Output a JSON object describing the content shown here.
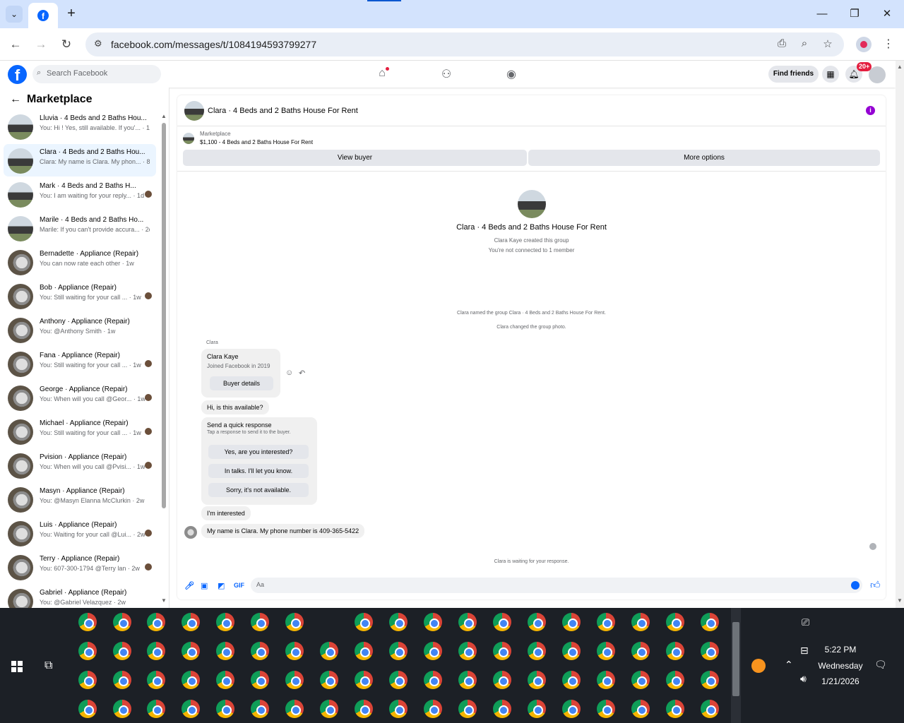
{
  "browser": {
    "url": "facebook.com/messages/t/1084194593799277",
    "new_tab_symbol": "+"
  },
  "facebook": {
    "search_placeholder": "Search Facebook",
    "find_friends": "Find friends",
    "notifications_badge": "20+"
  },
  "sidebar": {
    "title": "Marketplace",
    "conversations": [
      {
        "name": "Lluvia · 4 Beds and 2 Baths Hou...",
        "preview": "You: Hi ! Yes, still available. If you'... · 1m",
        "avatar": "house"
      },
      {
        "name": "Clara · 4 Beds and 2 Baths Hou...",
        "preview": "Clara: My name is Clara. My phon... · 8h",
        "avatar": "house"
      },
      {
        "name": "Mark · 4 Beds and 2 Baths H...",
        "preview": "You: I am waiting for your reply... · 1d",
        "avatar": "house"
      },
      {
        "name": "Marile · 4 Beds and 2 Baths Ho...",
        "preview": "Marile: If you can't provide accura... · 2d",
        "avatar": "house"
      },
      {
        "name": "Bernadette · Appliance (Repair)",
        "preview": "You can now rate each other · 1w",
        "avatar": "appliance"
      },
      {
        "name": "Bob · Appliance (Repair)",
        "preview": "You: Still waiting for your call ... · 1w",
        "avatar": "appliance"
      },
      {
        "name": "Anthony · Appliance (Repair)",
        "preview": "You: @Anthony Smith · 1w",
        "avatar": "appliance"
      },
      {
        "name": "Fana · Appliance (Repair)",
        "preview": "You: Still waiting for your call ... · 1w",
        "avatar": "appliance"
      },
      {
        "name": "George · Appliance (Repair)",
        "preview": "You: When will you call @Geor... · 1w",
        "avatar": "appliance"
      },
      {
        "name": "Michael · Appliance (Repair)",
        "preview": "You: Still waiting for your call ... · 1w",
        "avatar": "appliance"
      },
      {
        "name": "Pvision · Appliance (Repair)",
        "preview": "You: When will you call @Pvisi... · 1w",
        "avatar": "appliance"
      },
      {
        "name": "Masyn · Appliance (Repair)",
        "preview": "You: @Masyn Elanna McClurkin · 2w",
        "avatar": "appliance"
      },
      {
        "name": "Luis · Appliance (Repair)",
        "preview": "You: Waiting for your call @Lui... · 2w",
        "avatar": "appliance"
      },
      {
        "name": "Terry · Appliance (Repair)",
        "preview": "You: 607-300-1794 @Terry lan · 2w",
        "avatar": "appliance"
      },
      {
        "name": "Gabriel · Appliance (Repair)",
        "preview": "You: @Gabriel Velazquez · 2w",
        "avatar": "appliance"
      }
    ]
  },
  "chat": {
    "title": "Clara · 4 Beds and 2 Baths House For Rent",
    "marketplace_label": "Marketplace",
    "listing": "$1,100 - 4 Beds and 2 Baths House For Rent",
    "view_buyer": "View buyer",
    "more_options": "More options",
    "group_title": "Clara · 4 Beds and 2 Baths House For Rent",
    "group_created": "Clara Kaye created this group",
    "group_connected": "You're not connected to 1 member",
    "sys_named": "Clara named the group Clara · 4 Beds and 2 Baths House For Rent.",
    "sys_photo": "Clara changed the group photo.",
    "sender": "Clara",
    "card_name": "Clara Kaye",
    "card_joined": "Joined Facebook in 2019",
    "card_button": "Buyer details",
    "msg1": "Hi, is this available?",
    "qr_title": "Send a quick response",
    "qr_desc": "Tap a response to send it to the buyer.",
    "qr_options": [
      "Yes, are you interested?",
      "In talks. I'll let you know.",
      "Sorry, it's not available."
    ],
    "msg2": "I'm interested",
    "msg3": "My name is Clara. My phone number is 409-365-5422",
    "waiting": "Clara is waiting for your response.",
    "composer_placeholder": "Aa"
  },
  "taskbar": {
    "time": "5:22 PM",
    "day": "Wednesday",
    "date": "1/21/2026"
  }
}
